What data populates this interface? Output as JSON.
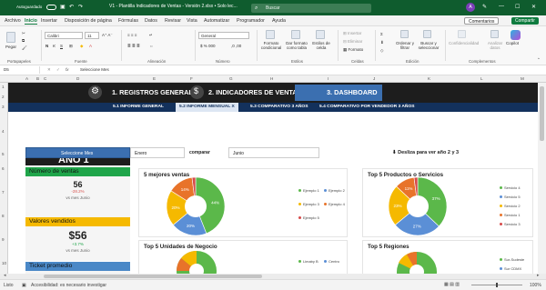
{
  "titlebar": {
    "autosave_label": "Autoguardado",
    "file_title": "V1 - Plantilla Indicadores de Ventas - Versión 2.xlsx  •  Solo lec...",
    "search_placeholder": "Buscar",
    "avatar_initial": "A"
  },
  "menu": {
    "items": [
      "Archivo",
      "Inicio",
      "Insertar",
      "Disposición de página",
      "Fórmulas",
      "Datos",
      "Revisar",
      "Vista",
      "Automatizar",
      "Programador",
      "Ayuda"
    ],
    "active": "Inicio",
    "comments_label": "Comentarios",
    "share_label": "Compartir"
  },
  "ribbon": {
    "paste_label": "Pegar",
    "font_name": "Calibri",
    "font_size": "11",
    "number_format": "General",
    "cond_format_label": "Formato condicional",
    "format_table_label": "Dar formato como tabla",
    "cell_styles_label": "Estilos de celda",
    "insert_label": "Insertar",
    "delete_label": "Eliminar",
    "format_label": "Formato",
    "sort_label": "Ordenar y filtrar",
    "find_label": "Buscar y seleccionar",
    "sensitivity_label": "Confidencialidad",
    "analyze_label": "Analizar datos",
    "copilot_label": "Copilot",
    "groups": [
      "Portapapeles",
      "Fuente",
      "Alineación",
      "Número",
      "Estilos",
      "Celdas",
      "Edición",
      "Complementos"
    ]
  },
  "formula": {
    "cell_ref": "D5",
    "fx": "fx",
    "content": "Seleccione Mes"
  },
  "columns": [
    "A",
    "B",
    "C",
    "D",
    "E",
    "F",
    "G",
    "H",
    "I",
    "J",
    "K",
    "L",
    "M"
  ],
  "rows": [
    "1",
    "2",
    "3",
    "4",
    "5",
    "6",
    "7",
    "8",
    "9",
    "10"
  ],
  "dashboard": {
    "nav": [
      {
        "label": "1. REGISTROS GENERALES",
        "icon": "gear-icon"
      },
      {
        "label": "2. INDICADORES DE VENTAS",
        "icon": "money-icon"
      },
      {
        "label": "3. DASHBOARD",
        "icon": ""
      }
    ],
    "subnav": [
      "5.1 INFORME GENERAL",
      "5.2 INFORME MENSUAL X",
      "5.3 COMPARATIVO 3 AÑOS",
      "5.4 COMPARATIVO POR VENDEDOR 3 AÑOS"
    ],
    "subnav_active": "5.2 INFORME MENSUAL X",
    "selector": {
      "label": "Seleccione Mes",
      "month": "Enero",
      "compare_label": "comparar",
      "compare_month": "Junio",
      "scroll_hint": "⬇ Desliza para ver año 2 y 3"
    },
    "year_label": "AÑO 1",
    "kpis": [
      {
        "title": "Número de ventas",
        "value": "56",
        "delta": "-28.2%",
        "sub": "vs mes Junio",
        "color": "#1fa54a",
        "delta_color": "#d9534f"
      },
      {
        "title": "Valores vendidos",
        "value": "$56",
        "delta": "+3.7%",
        "sub": "vs mes Junio",
        "color": "#f5b900",
        "delta_color": "#1fa54a"
      },
      {
        "title": "Ticket promedio",
        "color": "#4a88c7"
      }
    ],
    "panels": {
      "top5_sales": {
        "title": "5 mejores ventas",
        "legend": [
          "Ejemplo 1",
          "Ejemplo 2",
          "Ejemplo 3",
          "Ejemplo 4",
          "Ejemplo 5"
        ]
      },
      "top5_products": {
        "title": "Top 5 Productos o Servicios",
        "legend": [
          "Servicio 4",
          "Servicio 5",
          "Servicio 2",
          "Servicio 1",
          "Servicio 3"
        ]
      },
      "top5_units": {
        "title": "Top 5 Unidades de Negocio",
        "legend": [
          "Limaby B",
          "Centro"
        ]
      },
      "top5_regions": {
        "title": "Top 5 Regiones",
        "legend": [
          "Sur-Sudeste",
          "Sur CDMX"
        ]
      }
    }
  },
  "chart_data": [
    {
      "type": "pie",
      "title": "5 mejores ventas",
      "categories": [
        "Ejemplo 1",
        "Ejemplo 2",
        "Ejemplo 3",
        "Ejemplo 4",
        "Ejemplo 5"
      ],
      "values": [
        44,
        20,
        20,
        14,
        2
      ]
    },
    {
      "type": "pie",
      "title": "Top 5 Productos o Servicios",
      "categories": [
        "Servicio 4",
        "Servicio 5",
        "Servicio 2",
        "Servicio 1",
        "Servicio 3"
      ],
      "values": [
        37,
        27,
        23,
        11,
        2
      ]
    }
  ],
  "chart_colors": [
    "#5bb84a",
    "#5b8fd6",
    "#f5b900",
    "#e8732a",
    "#d64a4a"
  ],
  "status": {
    "ready": "Listo",
    "accessibility": "Accesibilidad: es necesario investigar",
    "zoom": "100%"
  }
}
